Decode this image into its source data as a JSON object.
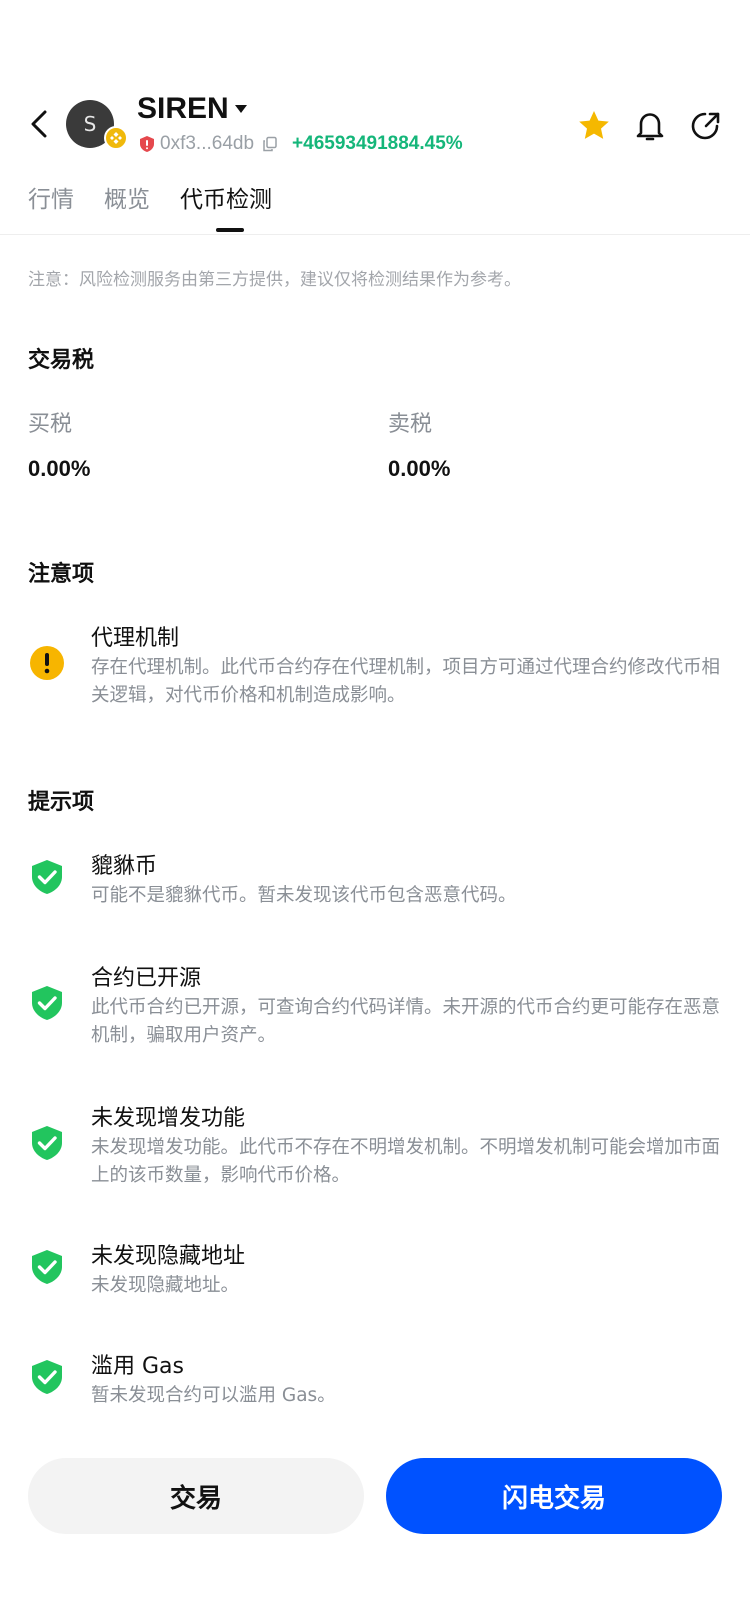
{
  "header": {
    "avatar_letter": "S",
    "token_name": "SIREN",
    "address": "0xf3...64db",
    "change": "+46593491884.45%",
    "icons": [
      "back-arrow-icon",
      "star-icon",
      "bell-icon",
      "share-icon"
    ],
    "colors": {
      "star": "#f5b800",
      "change": "#15b67a",
      "chain_badge": "#f0b90b"
    }
  },
  "tabs": [
    {
      "label": "行情"
    },
    {
      "label": "概览"
    },
    {
      "label": "代币检测"
    }
  ],
  "notice": "注意：风险检测服务由第三方提供，建议仅将检测结果作为参考。",
  "tax": {
    "title": "交易税",
    "buy_label": "买税",
    "buy_value": "0.00%",
    "sell_label": "卖税",
    "sell_value": "0.00%"
  },
  "attention": {
    "title": "注意项",
    "items": [
      {
        "icon": "warning-icon",
        "title": "代理机制",
        "desc": "存在代理机制。此代币合约存在代理机制，项目方可通过代理合约修改代币相关逻辑，对代币价格和机制造成影响。"
      }
    ]
  },
  "hints": {
    "title": "提示项",
    "items": [
      {
        "icon": "shield-check-icon",
        "title": "貔貅币",
        "desc": "可能不是貔貅代币。暂未发现该代币包含恶意代码。"
      },
      {
        "icon": "shield-check-icon",
        "title": "合约已开源",
        "desc": "此代币合约已开源，可查询合约代码详情。未开源的代币合约更可能存在恶意机制，骗取用户资产。"
      },
      {
        "icon": "shield-check-icon",
        "title": "未发现增发功能",
        "desc": "未发现增发功能。此代币不存在不明增发机制。不明增发机制可能会增加市面上的该币数量，影响代币价格。"
      },
      {
        "icon": "shield-check-icon",
        "title": "未发现隐藏地址",
        "desc": "未发现隐藏地址。"
      },
      {
        "icon": "shield-check-icon",
        "title": "滥用 Gas",
        "desc": "暂未发现合约可以滥用 Gas。"
      }
    ]
  },
  "buttons": {
    "trade": "交易",
    "flash_trade": "闪电交易",
    "colors": {
      "flash": "#0052ff",
      "trade_bg": "#f3f3f3"
    }
  }
}
